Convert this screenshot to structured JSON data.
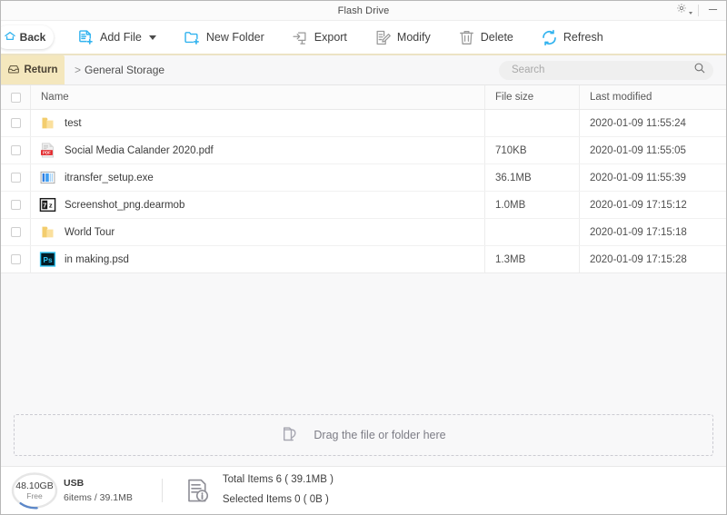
{
  "window": {
    "title": "Flash Drive",
    "settings_icon": "gear-icon",
    "minimize_icon": "minimize-icon"
  },
  "toolbar": {
    "back_label": "Back",
    "back_icon": "home-icon",
    "items": [
      {
        "label": "Add File",
        "icon": "add-file-icon",
        "caret": true
      },
      {
        "label": "New Folder",
        "icon": "new-folder-icon",
        "caret": false
      },
      {
        "label": "Export",
        "icon": "export-icon",
        "caret": false
      },
      {
        "label": "Modify",
        "icon": "modify-icon",
        "caret": false
      },
      {
        "label": "Delete",
        "icon": "trash-icon",
        "caret": false
      },
      {
        "label": "Refresh",
        "icon": "refresh-icon",
        "caret": false
      }
    ]
  },
  "navbar": {
    "return_label": "Return",
    "return_icon": "return-box-icon",
    "breadcrumb_separator": ">",
    "breadcrumb": "General Storage",
    "search": {
      "value": "",
      "placeholder": "Search",
      "icon": "search-icon"
    }
  },
  "table": {
    "columns": {
      "name": "Name",
      "size": "File size",
      "modified": "Last modified"
    },
    "rows": [
      {
        "name": "test",
        "icon": "folder-icon",
        "size": "",
        "modified": "2020-01-09 11:55:24",
        "checked": false
      },
      {
        "name": "Social Media Calander 2020.pdf",
        "icon": "pdf-icon",
        "size": "710KB",
        "modified": "2020-01-09 11:55:05",
        "checked": false
      },
      {
        "name": "itransfer_setup.exe",
        "icon": "exe-icon",
        "size": "36.1MB",
        "modified": "2020-01-09 11:55:39",
        "checked": false
      },
      {
        "name": "Screenshot_png.dearmob",
        "icon": "7z-icon",
        "size": "1.0MB",
        "modified": "2020-01-09 17:15:12",
        "checked": false
      },
      {
        "name": "World Tour",
        "icon": "folder-icon",
        "size": "",
        "modified": "2020-01-09 17:15:18",
        "checked": false
      },
      {
        "name": "in making.psd",
        "icon": "psd-icon",
        "size": "1.3MB",
        "modified": "2020-01-09 17:15:28",
        "checked": false
      }
    ]
  },
  "dropzone": {
    "label": "Drag the file or folder here",
    "icon": "folder-drop-icon"
  },
  "status": {
    "capacity": "48.10GB",
    "capacity_sub": "Free",
    "device_name": "USB",
    "device_sub": "6items / 39.1MB",
    "info_icon": "doc-info-icon",
    "total_items": "Total Items  6  ( 39.1MB )",
    "selected_items": "Selected Items  0  ( 0B )"
  },
  "colors": {
    "accent": "#32b3ef",
    "tab_gold": "#f4e7bd",
    "toolbar_underline": "#ece3c4",
    "pdf_red": "#e2282b",
    "psd_cyan": "#31c5f4",
    "folder_yellow": "#f6d77f"
  }
}
